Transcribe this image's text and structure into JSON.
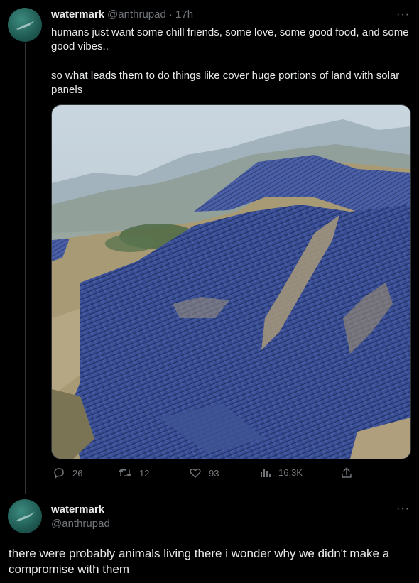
{
  "tweet": {
    "display_name": "watermark",
    "handle": "@anthrupad",
    "time": "· 17h",
    "more": "···",
    "text_line1": "humans just want some chill friends, some love, some good food, and some good vibes..",
    "text_line2": "so what leads them to do things like cover huge portions of land with solar panels",
    "actions": {
      "replies": "26",
      "retweets": "12",
      "likes": "93",
      "views": "16.3K"
    }
  },
  "reply": {
    "display_name": "watermark",
    "handle": "@anthrupad",
    "more": "···",
    "text": "there were probably animals living there i wonder why we didn't make a compromise with them"
  },
  "colors": {
    "background": "#000000",
    "text": "#e7e9ea",
    "muted": "#71767b",
    "avatar": "#2e7b70"
  }
}
